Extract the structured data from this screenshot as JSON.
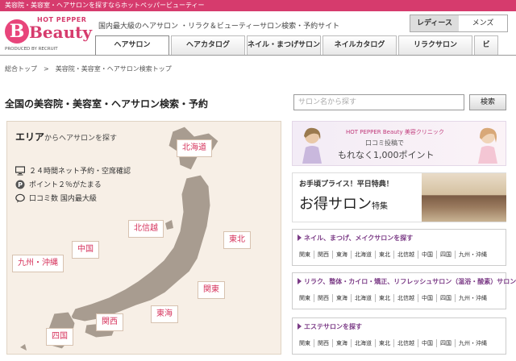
{
  "top_strip": "美容院・美容室・ヘアサロンを探すならホットペッパービューティー",
  "logo": {
    "badge": "B",
    "brand_top": "HOT PEPPER",
    "brand": "Beauty",
    "produced_by": "PRODUCED BY RECRUIT"
  },
  "header": {
    "tagline": "国内最大級のヘアサロン ・リラク＆ビューティーサロン検索・予約サイト"
  },
  "gender_toggle": {
    "ladies": "レディース",
    "mens": "メンズ"
  },
  "tabs": [
    "ヘアサロン",
    "ヘアカタログ",
    "ネイル・まつげサロン",
    "ネイルカタログ",
    "リラクサロン",
    "ビ"
  ],
  "breadcrumb": [
    "総合トップ",
    "美容院・美容室・ヘアサロン検索トップ"
  ],
  "breadcrumb_sep": ">",
  "page_title": "全国の美容院・美容室・ヘアサロン検索・予約",
  "search": {
    "placeholder": "サロン名から探す",
    "button": "検索"
  },
  "area": {
    "title_big": "エリア",
    "title_small": "からヘアサロンを探す",
    "features": [
      "２４時間ネット予約・空席確認",
      "ポイント２％がたまる",
      "口コミ数 国内最大級"
    ],
    "regions": {
      "hokkaido": "北海道",
      "tohoku": "東北",
      "hokushinetsu": "北信越",
      "kanto": "関東",
      "tokai": "東海",
      "kansai": "関西",
      "chugoku": "中国",
      "shikoku": "四国",
      "kyushu": "九州・沖縄"
    }
  },
  "banner_clinic": {
    "brand": "HOT PEPPER Beauty 美容クリニック",
    "line1": "口コミ投稿で",
    "line2": "もれなく1,000ポイント"
  },
  "banner_deal": {
    "title": "お手頃プライス！平日特典！",
    "main": "お得サロン",
    "sub": "特集"
  },
  "categories": [
    {
      "title": "ネイル、まつげ、メイクサロンを探す",
      "links": [
        "関東",
        "関西",
        "東海",
        "北海道",
        "東北",
        "北信越",
        "中国",
        "四国",
        "九州・沖縄"
      ]
    },
    {
      "title": "リラク、整体・カイロ・矯正、リフレッシュサロン（温浴・酸素）サロンを探す",
      "links": [
        "関東",
        "関西",
        "東海",
        "北海道",
        "東北",
        "北信越",
        "中国",
        "四国",
        "九州・沖縄"
      ]
    },
    {
      "title": "エステサロンを探す",
      "links": [
        "関東",
        "関西",
        "東海",
        "北海道",
        "東北",
        "北信越",
        "中国",
        "四国",
        "九州・沖縄"
      ]
    }
  ],
  "colors": {
    "brand_pink": "#d63b6d",
    "region_text": "#d6335c",
    "map_fill": "#a89c90",
    "category_purple": "#7b3b86"
  },
  "icons": [
    "monitor-icon",
    "point-icon",
    "speech-bubble-icon"
  ]
}
